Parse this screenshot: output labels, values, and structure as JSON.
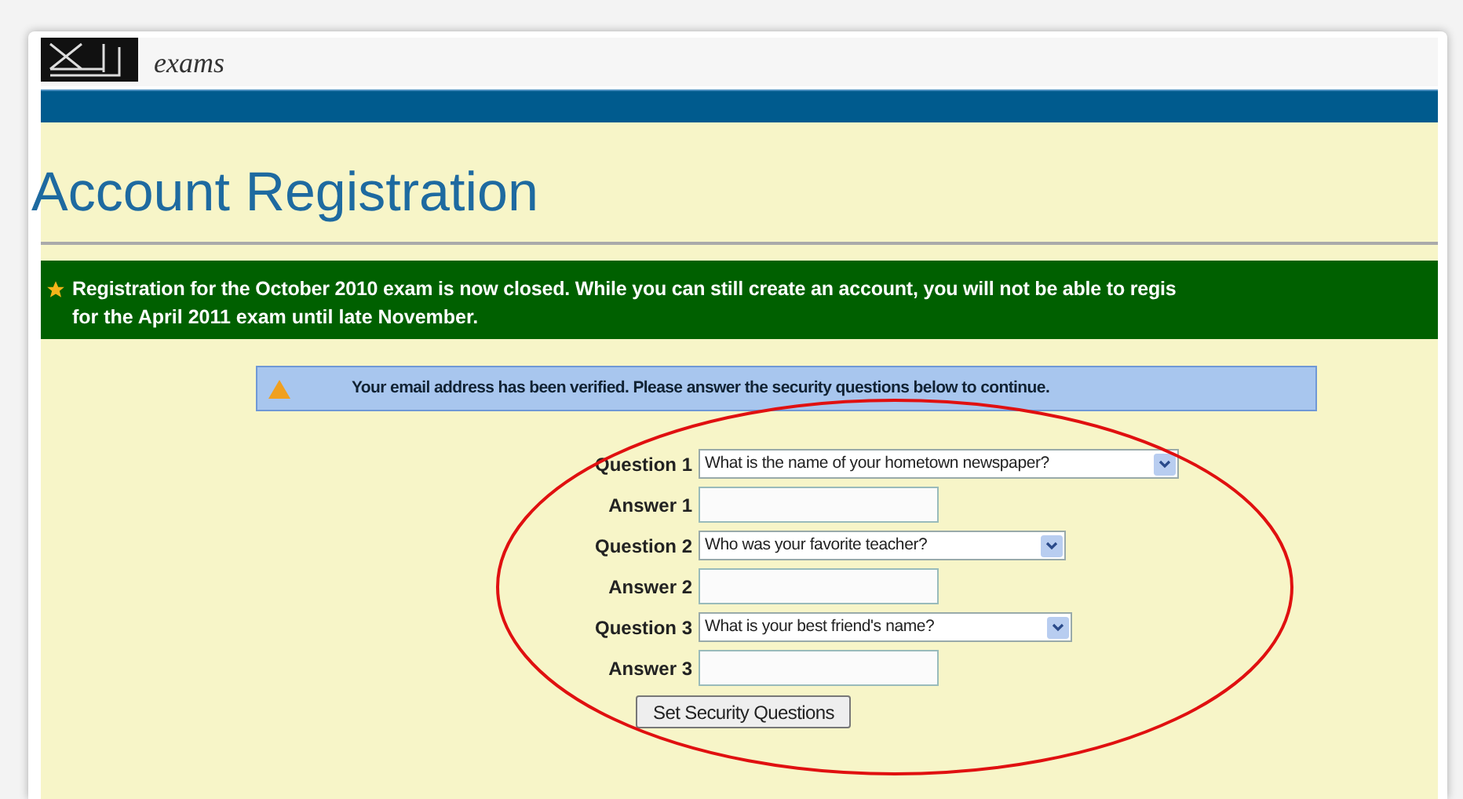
{
  "header": {
    "tagline": "exams"
  },
  "page_title": "Account Registration",
  "notice": {
    "lines": [
      "Registration for the October 2010 exam is now closed. While you can still create an account, you will not be able to regis",
      "for the April 2011 exam until late November."
    ]
  },
  "info_message": "Your email address has been verified. Please answer the security questions below to continue.",
  "form": {
    "rows": [
      {
        "kind": "select",
        "label": "Question 1",
        "value": "What is the name of your hometown newspaper?"
      },
      {
        "kind": "text",
        "label": "Answer 1"
      },
      {
        "kind": "select",
        "label": "Question 2",
        "value": "Who was your favorite teacher?"
      },
      {
        "kind": "text",
        "label": "Answer 2"
      },
      {
        "kind": "select",
        "label": "Question 3",
        "value": "What is your best friend's name?"
      },
      {
        "kind": "text",
        "label": "Answer 3"
      }
    ],
    "submit": "Set Security Questions"
  }
}
